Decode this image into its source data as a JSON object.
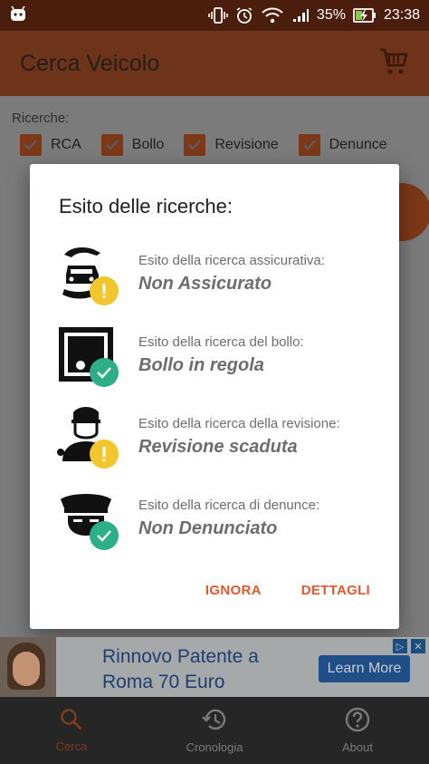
{
  "status_bar": {
    "battery": "35%",
    "time": "23:38"
  },
  "app_bar": {
    "title": "Cerca Veicolo",
    "cart_icon": "cart-icon"
  },
  "search": {
    "label": "Ricerche:",
    "checkboxes": [
      {
        "label": "RCA",
        "checked": true
      },
      {
        "label": "Bollo",
        "checked": true
      },
      {
        "label": "Revisione",
        "checked": true
      },
      {
        "label": "Denunce",
        "checked": true
      }
    ]
  },
  "dialog": {
    "title": "Esito delle ricerche:",
    "results": [
      {
        "label": "Esito della ricerca assicurativa:",
        "value": "Non Assicurato",
        "icon": "insurance-hand-car-icon",
        "status": "warning"
      },
      {
        "label": "Esito della ricerca del bollo:",
        "value": "Bollo in regola",
        "icon": "stamp-icon",
        "status": "ok"
      },
      {
        "label": "Esito della ricerca della revisione:",
        "value": "Revisione scaduta",
        "icon": "mechanic-icon",
        "status": "warning"
      },
      {
        "label": "Esito della ricerca di denunce:",
        "value": "Non Denunciato",
        "icon": "police-icon",
        "status": "ok"
      }
    ],
    "actions": {
      "ignore": "IGNORA",
      "details": "DETTAGLI"
    },
    "colors": {
      "accent": "#e8572b",
      "warning": "#f2c62f",
      "ok": "#2cae87"
    }
  },
  "ad": {
    "title": "Rinnovo Patente a Roma 70 Euro",
    "cta": "Learn More"
  },
  "bottom_nav": {
    "items": [
      {
        "label": "Cerca",
        "icon": "search-icon",
        "active": true
      },
      {
        "label": "Cronologia",
        "icon": "history-icon",
        "active": false
      },
      {
        "label": "About",
        "icon": "help-icon",
        "active": false
      }
    ]
  }
}
